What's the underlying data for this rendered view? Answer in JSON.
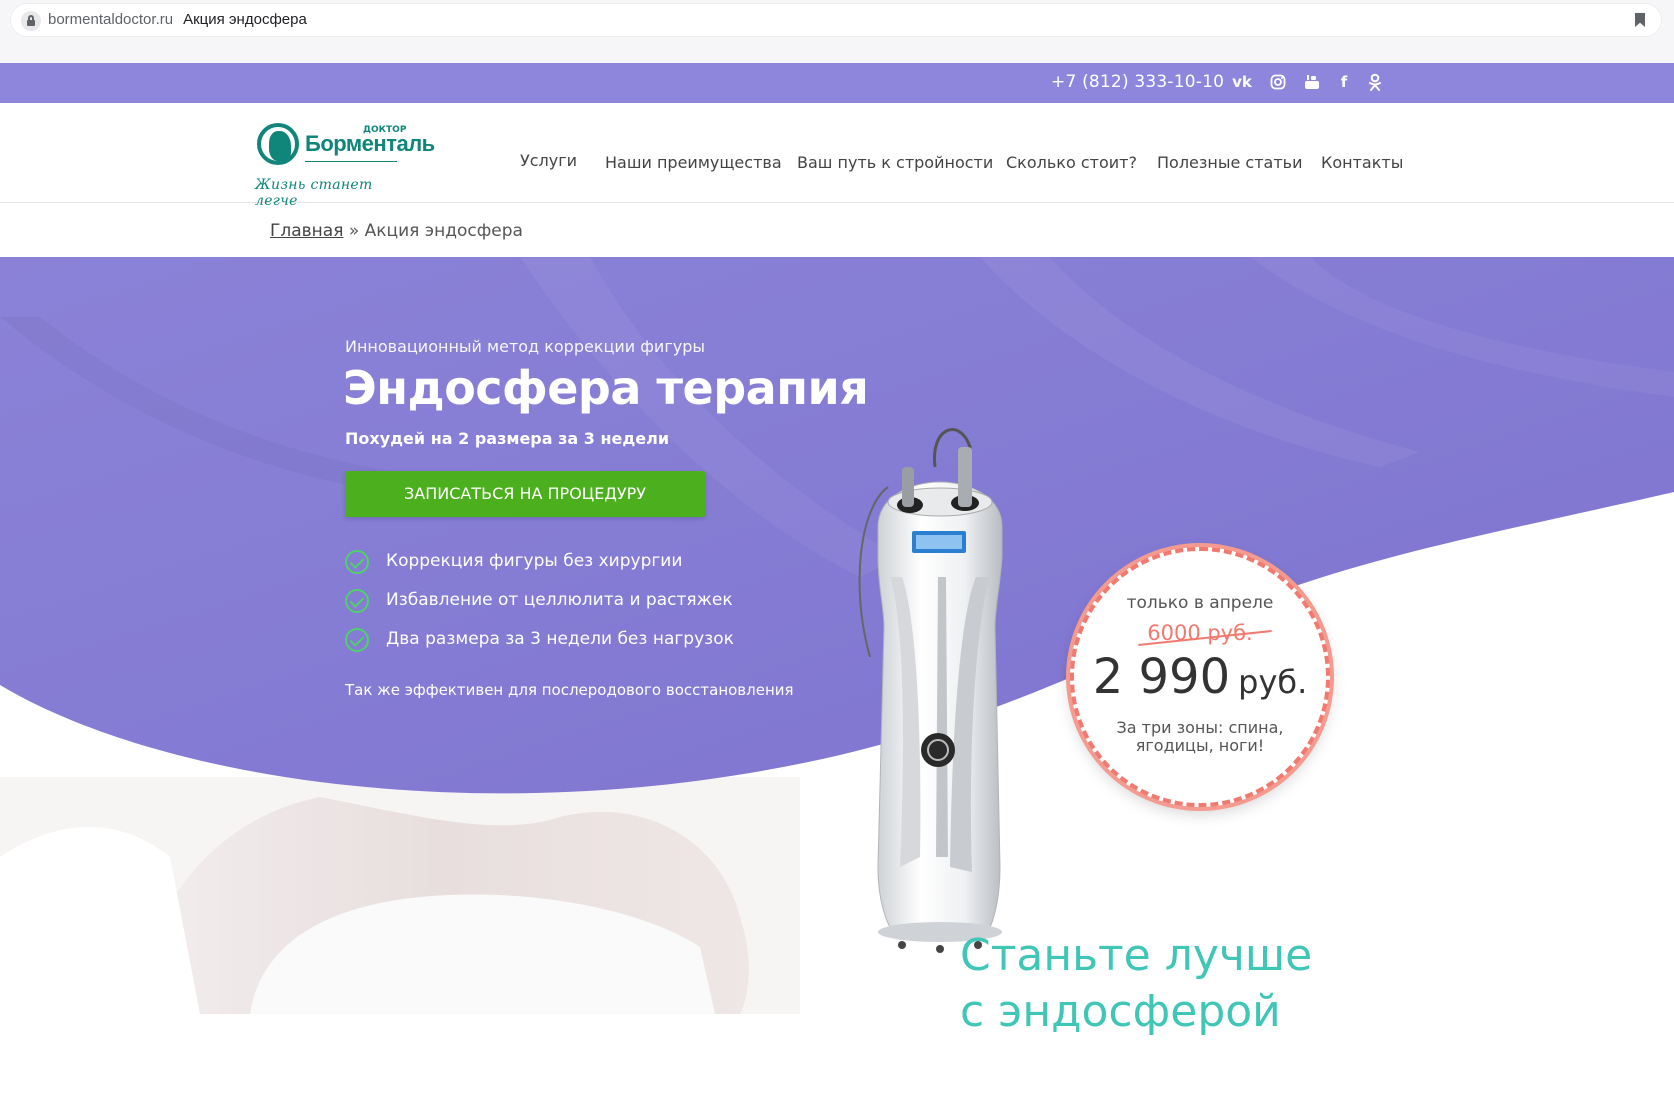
{
  "browser": {
    "domain": "bormentaldoctor.ru",
    "tab_title": "Акция эндосфера"
  },
  "topbar": {
    "phone": "+7 (812) 333-10-10",
    "social": [
      "vk-icon",
      "instagram-icon",
      "youtube-icon",
      "facebook-icon",
      "odnoklassniki-icon"
    ]
  },
  "logo": {
    "small": "ДОКТОР",
    "name": "Борменталь",
    "slogan": "Жизнь станет легче"
  },
  "nav": {
    "items": [
      "Услуги",
      "Наши преимущества",
      "Ваш путь к стройности",
      "Сколько стоит?",
      "Полезные статьи",
      "Контакты"
    ]
  },
  "breadcrumb": {
    "home": "Главная",
    "sep": " » ",
    "current": "Акция эндосфера"
  },
  "hero": {
    "subtitle": "Инновационный метод коррекции фигуры",
    "title": "Эндосфера терапия",
    "tagline": "Похудей на 2 размера за 3 недели",
    "cta": "ЗАПИСАТЬСЯ НА ПРОЦЕДУРУ",
    "features": [
      "Коррекция фигуры без хирургии",
      "Избавление от целлюлита и растяжек",
      "Два размера за 3 недели без нагрузок"
    ],
    "note": "Так же эффективен для послеродового восстановления"
  },
  "price": {
    "when": "только в апреле",
    "old": "6000 руб.",
    "new": "2 990",
    "currency": "руб.",
    "zones": "За три зоны: спина, ягодицы, ноги!"
  },
  "bottom": {
    "headline_1": "Станьте лучше",
    "headline_2": "с эндосферой"
  },
  "colors": {
    "purple": "#8e86dc",
    "green": "#4caf1e",
    "teal": "#3fc6b7",
    "coral": "#f07a70",
    "logo_green": "#10857a"
  }
}
